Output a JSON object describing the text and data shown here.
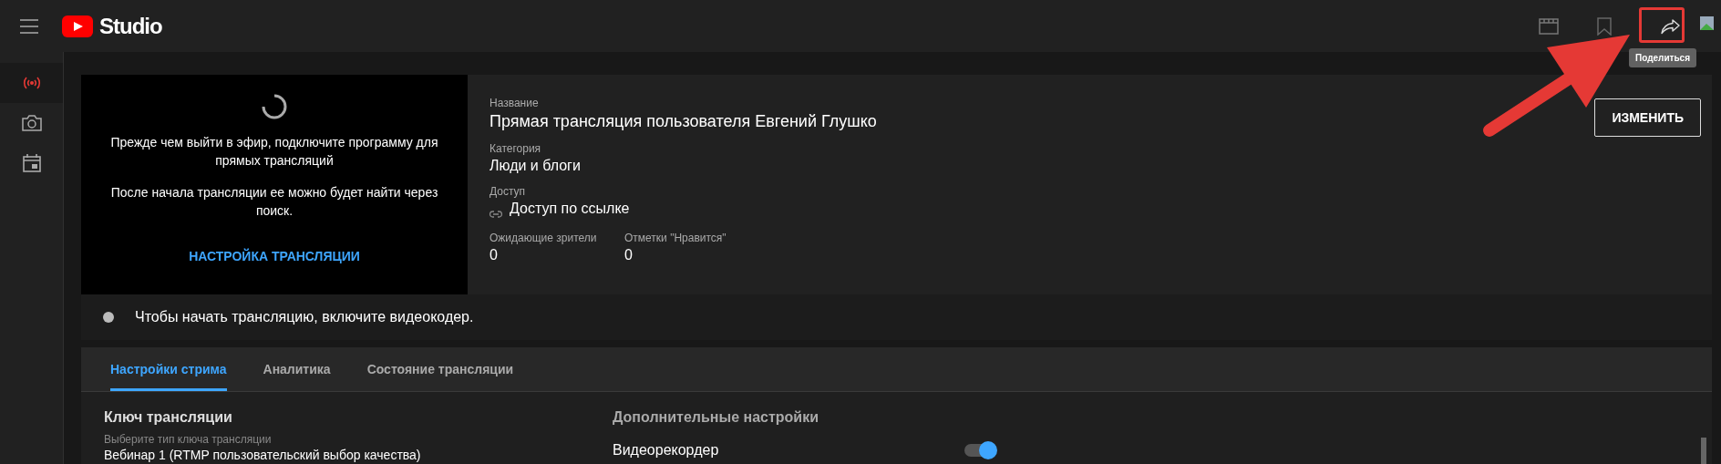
{
  "header": {
    "logo_text": "Studio",
    "tooltip": "Поделиться"
  },
  "sidebar": {
    "items": [
      {
        "kind": "live",
        "selected": true
      },
      {
        "kind": "camera",
        "selected": false
      },
      {
        "kind": "calendar",
        "selected": false
      }
    ]
  },
  "preview": {
    "messages": [
      "Прежде чем выйти в эфир, подключите программу для прямых трансляций",
      "После начала трансляции ее можно будет найти через поиск."
    ],
    "link": "НАСТРОЙКА ТРАНСЛЯЦИИ"
  },
  "details": {
    "title_label": "Название",
    "title": "Прямая трансляция пользователя Евгений Глушко",
    "category_label": "Категория",
    "category": "Люди и блоги",
    "access_label": "Доступ",
    "access": "Доступ по ссылке",
    "stats": [
      {
        "label": "Ожидающие зрители",
        "value": "0"
      },
      {
        "label": "Отметки \"Нравится\"",
        "value": "0"
      }
    ],
    "edit_button": "ИЗМЕНИТЬ"
  },
  "status": {
    "message": "Чтобы начать трансляцию, включите видеокодер."
  },
  "tabs": [
    {
      "label": "Настройки стрима",
      "selected": true
    },
    {
      "label": "Аналитика",
      "selected": false
    },
    {
      "label": "Состояние трансляции",
      "selected": false
    }
  ],
  "stream_key": {
    "heading": "Ключ трансляции",
    "field_label": "Выберите тип ключа трансляции",
    "value": "Вебинар 1 (RTMP пользовательский выбор качества)"
  },
  "extra": {
    "heading": "Дополнительные настройки",
    "settings": [
      {
        "label": "Видеорекордер",
        "on": true
      }
    ]
  }
}
